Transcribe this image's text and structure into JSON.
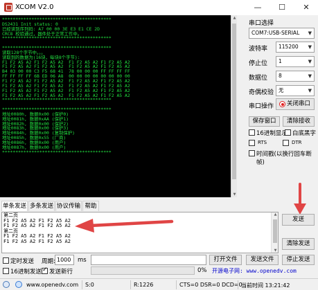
{
  "window": {
    "title": "XCOM V2.0",
    "minimize": "—",
    "maximize": "☐",
    "close": "✕"
  },
  "terminal": {
    "lines": [
      "*****************************************",
      "DS2431 Init status: 0",
      "已经读到序列码: A7 00 00 3E E3 E1 CE 2D",
      "CRC8 校验通过，器件处于正常工作中。",
      "*****************************************",
      "",
      "*****************************************",
      "读取128个字节中。。。",
      "读取到的数据为(16块，每块8个字节):",
      "F1 F2 A5 A2 F1 F2 A5 A2  F1 F2 A5 A2 F1 F2 A5 A2",
      "F1 F2 A5 A2 F1 F2 A5 A2  F1 F2 A5 A2 F1 F2 A5 A2",
      "B4 03 00 00 C3 F5 68 41  78 00 00 00 FF FF FF FF",
      "FF FF FF FF 6B ED 06 A8  00 00 00 00 00 00 00 00",
      "F1 F2 A5 A2 F1 F2 A5 A2  F1 F2 A5 A2 F1 F2 A5 A2",
      "F1 F2 A5 A2 F1 F2 A5 A2  F1 F2 A5 A2 F1 F2 A5 A2",
      "F1 F2 A5 A2 F1 F2 A5 A2  F1 F2 A5 A2 F1 F2 A5 A2",
      "F1 F2 A5 A2 F1 F2 A5 A2  F1 F2 A5 A2 F1 F2 A5 A2",
      "*****************************************",
      "",
      "*****************************************",
      "地址0080h, 数据0x00 (保护0)",
      "地址0081h, 数据0xAA (保护1)",
      "地址0082h, 数据0x00 (保护2)",
      "地址0083h, 数据0x00 (保护3)",
      "地址0084h, 数据0x00 (复制保护)",
      "地址0085h, 数据0x55 (厂商)",
      "地址0086h, 数据0x00 (用户)",
      "地址0087h, 数据0x00 (用户)",
      "*****************************************"
    ]
  },
  "right_panel": {
    "port_select_label": "串口选择",
    "port_value": "COM7:USB-SERIAL",
    "baud_label": "波特率",
    "baud_value": "115200",
    "stopbits_label": "停止位",
    "stopbits_value": "1",
    "databits_label": "数据位",
    "databits_value": "8",
    "parity_label": "奇偶校验",
    "parity_value": "无",
    "port_op_label": "串口操作",
    "close_port_button": "关闭串口",
    "save_window_button": "保存窗口",
    "clear_receive_button": "清除接收",
    "hex_display_label": "16进制显示",
    "white_on_black_label": "白底黑字",
    "rts_label": "RTS",
    "dtr_label": "DTR",
    "timestamp_label": "时间戳(以换行回车断帧)",
    "accent_red": "#e02020"
  },
  "tabs": [
    "单条发送",
    "多条发送",
    "协议传输",
    "帮助"
  ],
  "send": {
    "lines": [
      "第二页",
      "F1 F2 A5 A2 F1 F2 A5 A2",
      "F1 F2 A5 A2 F1 F2 A5 A2",
      "第二页",
      "F1 F2 A5 A2 F1 F2 A5 A2",
      "F1 F2 A5 A2 F1 F2 A5 A2"
    ],
    "send_button": "发送",
    "clear_send_button": "清除发送"
  },
  "bottom": {
    "timed_send_label": "定时发送",
    "period_label": "周期:",
    "period_value": "1000",
    "period_unit": "ms",
    "hex_send_label": "16进制发送",
    "send_newline_label": "发送新行",
    "send_newline_checked": true,
    "open_file_button": "打开文件",
    "send_file_button": "发送文件",
    "stop_send_button": "停止发送",
    "progress_percent": "0%",
    "progress_value": 0,
    "brand_text": "开源电子网: www.openedv.com"
  },
  "statusbar": {
    "url": "www.openedv.com",
    "s_count": "S:0",
    "r_count": "R:1226",
    "signals": "CTS=0 DSR=0 DCD=0",
    "time": "当前时间 13:21:42"
  }
}
